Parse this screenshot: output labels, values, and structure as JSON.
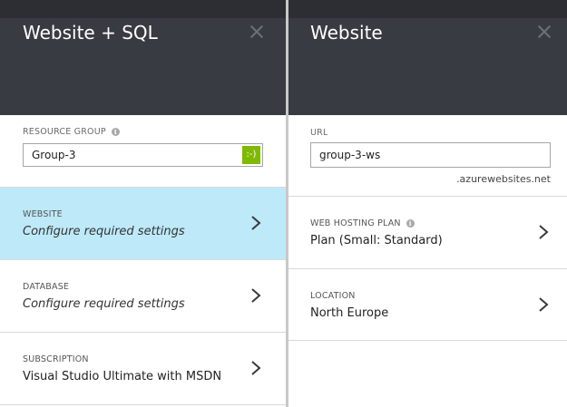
{
  "left_blade": {
    "title": "Website + SQL",
    "resource_group": {
      "label": "RESOURCE GROUP",
      "value": "Group-3",
      "valid_badge": ":-)"
    },
    "rows": [
      {
        "label": "WEBSITE",
        "value": "Configure required settings",
        "selected": true,
        "icon": "chevron-right-icon"
      },
      {
        "label": "DATABASE",
        "value": "Configure required settings",
        "selected": false,
        "icon": "chevron-right-icon"
      },
      {
        "label": "SUBSCRIPTION",
        "value": "Visual Studio Ultimate with MSDN",
        "selected": false,
        "icon": "chevron-right-icon"
      }
    ]
  },
  "right_blade": {
    "title": "Website",
    "url": {
      "label": "URL",
      "value": "group-3-ws",
      "suffix": ".azurewebsites.net"
    },
    "rows": [
      {
        "label": "WEB HOSTING PLAN",
        "value": "Plan (Small: Standard)",
        "icon": "chevron-right-icon"
      },
      {
        "label": "LOCATION",
        "value": "North Europe",
        "icon": "chevron-right-icon"
      }
    ]
  },
  "colors": {
    "header_bg": "#393b42",
    "selected_row_bg": "#bde9f8",
    "valid_badge": "#7fba00",
    "divider": "#c8c8c8"
  }
}
